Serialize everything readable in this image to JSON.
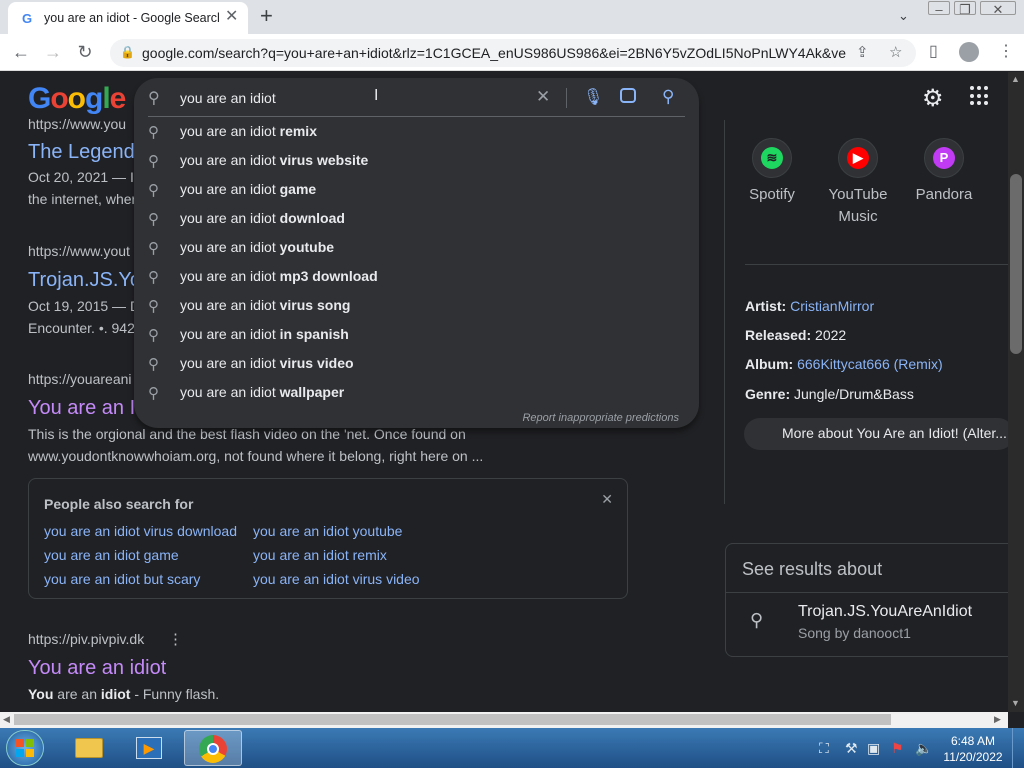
{
  "browser": {
    "tab_title": "you are an idiot - Google Search",
    "tab_favicon": "G",
    "new_tab": "+",
    "url": "google.com/search?q=you+are+an+idiot&rlz=1C1GCEA_enUS986US986&ei=2BN6Y5vZOdLI5NoPnLWY4Ak&ve..."
  },
  "header": {
    "logo": "Google",
    "query": "you are an idiot"
  },
  "suggestions": {
    "prefix": "you are an idiot",
    "items": [
      {
        "bold": "remix"
      },
      {
        "bold": "virus website"
      },
      {
        "bold": "game"
      },
      {
        "bold": "download"
      },
      {
        "bold": "youtube"
      },
      {
        "bold": "mp3 download"
      },
      {
        "bold": "virus song"
      },
      {
        "bold": "in spanish"
      },
      {
        "bold": "virus video"
      },
      {
        "bold": "wallpaper"
      }
    ],
    "report": "Report inappropriate predictions"
  },
  "results": [
    {
      "cite": "https://www.you",
      "title": "The Legend",
      "date": "Oct 20, 2021 — In",
      "snippet": "the internet, wher"
    },
    {
      "cite": "https://www.yout",
      "title": "Trojan.JS.Yo",
      "date": "Oct 19, 2015 — D",
      "snippet": "Encounter. •. 942"
    },
    {
      "cite": "https://youareani",
      "title": "You are an I",
      "snippet1": "This is the orgional and the best flash video on the 'net. Once found on",
      "snippet2": "www.youdontknowwhoiam.org, not found where it belong, right here on ..."
    }
  ],
  "people_also_search": {
    "heading": "People also search for",
    "links": [
      "you are an idiot virus download",
      "you are an idiot youtube",
      "you are an idiot game",
      "you are an idiot remix",
      "you are an idiot but scary",
      "you are an idiot virus video"
    ]
  },
  "result4": {
    "cite": "https://piv.pivpiv.dk",
    "title": "You are an idiot",
    "snippet_b1": "You",
    "snippet_t1": " are an ",
    "snippet_b2": "idiot",
    "snippet_t2": " - Funny flash."
  },
  "knowledge_panel": {
    "services": [
      {
        "name": "Spotify",
        "color": "#1ed760"
      },
      {
        "name": "YouTube\nMusic",
        "line1": "YouTube",
        "line2": "Music",
        "color": "#ff0000"
      },
      {
        "name": "Pandora",
        "color": "#c13bf5"
      }
    ],
    "artist_label": "Artist:",
    "artist": "CristianMirror",
    "released_label": "Released:",
    "released": "2022",
    "album_label": "Album:",
    "album": "666Kittycat666 (Remix)",
    "genre_label": "Genre:",
    "genre": "Jungle/Drum&Bass",
    "more": "More about You Are an Idiot! (Alter...",
    "see_results": "See results about",
    "entity_title": "Trojan.JS.YouAreAnIdiot",
    "entity_sub": "Song by danooct1"
  },
  "taskbar": {
    "time": "6:48 AM",
    "date": "11/20/2022"
  }
}
